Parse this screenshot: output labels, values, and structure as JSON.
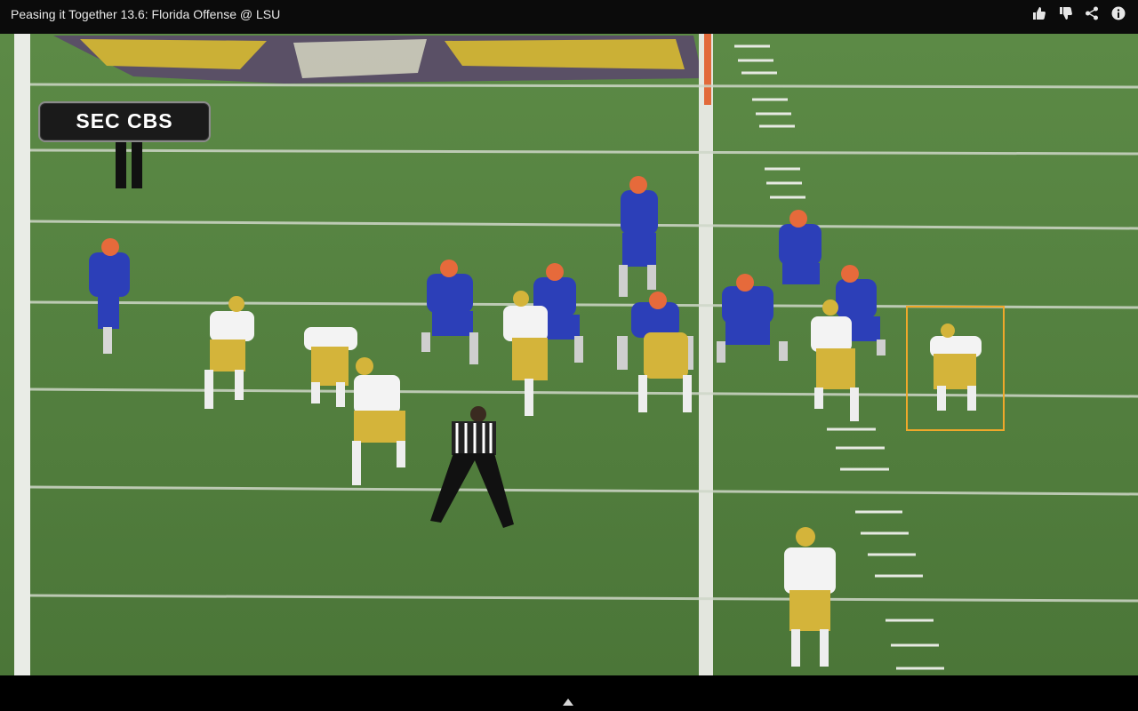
{
  "header": {
    "title": "Peasing it Together 13.6: Florida Offense @ LSU",
    "actions": [
      {
        "name": "thumbs-up-icon"
      },
      {
        "name": "thumbs-down-icon"
      },
      {
        "name": "share-icon"
      },
      {
        "name": "info-icon"
      }
    ]
  },
  "video": {
    "network_logo": "SEC CBS",
    "highlight_color": "#f0a82a",
    "florida_jersey_color": "#2c3fb8",
    "lsu_jersey_color": "#f3f3f3",
    "lsu_pants_color": "#d4b43a",
    "field_color": "#4f7a3b"
  },
  "footer": {
    "expand_control": "chevron-up-icon"
  }
}
